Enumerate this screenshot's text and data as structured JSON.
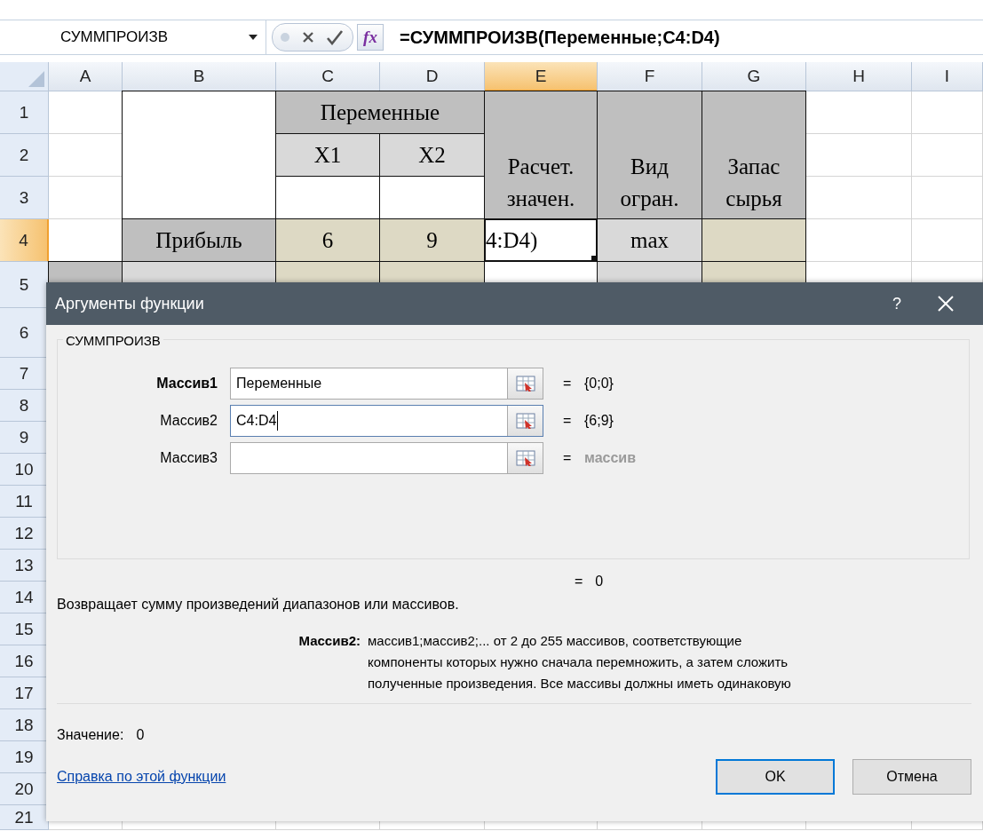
{
  "formula_bar": {
    "name_box": "СУММПРОИЗВ",
    "function_button": "fx",
    "formula": "=СУММПРОИЗВ(Переменные;C4:D4)"
  },
  "sheet": {
    "columns": [
      {
        "label": "A",
        "selected": false
      },
      {
        "label": "B",
        "selected": false
      },
      {
        "label": "C",
        "selected": false
      },
      {
        "label": "D",
        "selected": false
      },
      {
        "label": "E",
        "selected": true
      },
      {
        "label": "F",
        "selected": false
      },
      {
        "label": "G",
        "selected": false
      },
      {
        "label": "H",
        "selected": false
      },
      {
        "label": "I",
        "selected": false
      }
    ],
    "rows": [
      {
        "label": "1",
        "selected": false
      },
      {
        "label": "2",
        "selected": false
      },
      {
        "label": "3",
        "selected": false
      },
      {
        "label": "4",
        "selected": true
      },
      {
        "label": "5",
        "selected": false
      },
      {
        "label": "6",
        "selected": false
      },
      {
        "label": "7",
        "selected": false
      },
      {
        "label": "8",
        "selected": false
      },
      {
        "label": "9",
        "selected": false
      },
      {
        "label": "10",
        "selected": false
      },
      {
        "label": "11",
        "selected": false
      },
      {
        "label": "12",
        "selected": false
      },
      {
        "label": "13",
        "selected": false
      },
      {
        "label": "14",
        "selected": false
      },
      {
        "label": "15",
        "selected": false
      },
      {
        "label": "16",
        "selected": false
      },
      {
        "label": "17",
        "selected": false
      },
      {
        "label": "18",
        "selected": false
      },
      {
        "label": "19",
        "selected": false
      },
      {
        "label": "20",
        "selected": false
      },
      {
        "label": "21",
        "selected": false
      }
    ],
    "cells": [
      {
        "kind": "header",
        "text": "Переменные"
      },
      {
        "kind": "subheader",
        "text": "X1"
      },
      {
        "kind": "subheader",
        "text": "X2"
      },
      {
        "kind": "header",
        "text": "Расчет. значен."
      },
      {
        "kind": "header",
        "text": "Вид огран."
      },
      {
        "kind": "header",
        "text": "Запас сырья"
      },
      {
        "kind": "plain"
      },
      {
        "kind": "plain"
      },
      {
        "kind": "plain"
      },
      {
        "kind": "header",
        "text": "Прибыль"
      },
      {
        "kind": "value",
        "text": "6"
      },
      {
        "kind": "value",
        "text": "9"
      },
      {
        "kind": "active",
        "text": "4:D4)"
      },
      {
        "kind": "subheader",
        "text": "max"
      },
      {
        "kind": "value"
      },
      {
        "kind": "header"
      },
      {
        "kind": "subheader"
      },
      {
        "kind": "value"
      },
      {
        "kind": "value"
      },
      {
        "kind": "plain"
      },
      {
        "kind": "subheader"
      },
      {
        "kind": "value"
      }
    ]
  },
  "dialog": {
    "title": "Аргументы функции",
    "help": "?",
    "group": "СУММПРОИЗВ",
    "arguments": [
      {
        "label": "Массив1",
        "required": true,
        "value": "Переменные",
        "focused": false,
        "equals": "=",
        "result": "{0;0}",
        "muted": false
      },
      {
        "label": "Массив2",
        "required": false,
        "value": "C4:D4",
        "focused": true,
        "equals": "=",
        "result": "{6;9}",
        "muted": false
      },
      {
        "label": "Массив3",
        "required": false,
        "focused": false,
        "equals": "=",
        "result": "массив",
        "muted": true
      }
    ],
    "formula_result": {
      "equals": "=",
      "value": "0"
    },
    "description": "Возвращает сумму произведений диапазонов или массивов.",
    "argument_help": {
      "label": "Массив2:",
      "lines": [
        "массив1;массив2;... от 2 до 255 массивов, соответствующие",
        "компоненты которых нужно сначала перемножить, а затем сложить",
        "полученные произведения. Все массивы должны иметь одинаковую"
      ]
    },
    "value_label": "Значение:",
    "value": "0",
    "help_link": "Справка по этой функции",
    "buttons": [
      {
        "label": "OK",
        "default": true
      },
      {
        "label": "Отмена",
        "default": false
      }
    ]
  }
}
